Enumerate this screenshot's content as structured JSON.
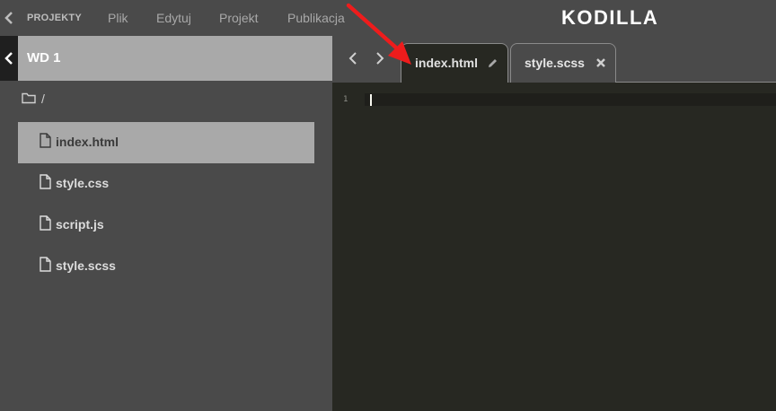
{
  "menubar": {
    "projects_label": "PROJEKTY",
    "items": [
      "Plik",
      "Edytuj",
      "Projekt",
      "Publikacja"
    ],
    "logo": "KODILLA"
  },
  "sidebar": {
    "project_title": "WD 1",
    "root_folder": "/",
    "files": [
      {
        "name": "index.html",
        "active": true
      },
      {
        "name": "style.css",
        "active": false
      },
      {
        "name": "script.js",
        "active": false
      },
      {
        "name": "style.scss",
        "active": false
      }
    ]
  },
  "editor": {
    "tabs": [
      {
        "label": "index.html",
        "icon": "pencil-icon",
        "active": true
      },
      {
        "label": "style.scss",
        "icon": "close-icon",
        "active": false
      }
    ],
    "line_numbers": [
      "1"
    ]
  },
  "colors": {
    "menubar_bg": "#4a4a4a",
    "sidebar_bg": "#4a4a4a",
    "active_row_bg": "#a9a9a9",
    "editor_bg": "#272822",
    "annotation_arrow": "#ee1c1c"
  }
}
